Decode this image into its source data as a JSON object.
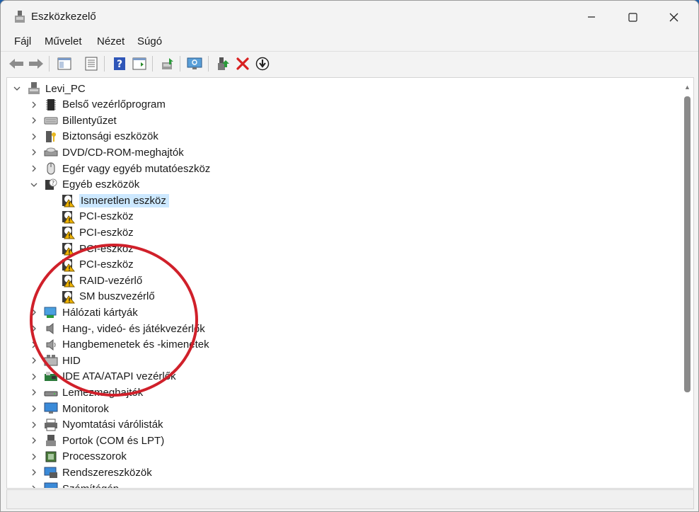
{
  "window": {
    "title": "Eszközkezelő"
  },
  "caption": {
    "minimize": "—",
    "maximize": "☐",
    "close": "✕"
  },
  "menu": {
    "items": [
      "Fájl",
      "Művelet",
      "Nézet",
      "Súgó"
    ]
  },
  "toolbar": {
    "icons": [
      "back-arrow-icon",
      "forward-arrow-icon",
      "properties-pane-icon",
      "details-list-icon",
      "help-icon",
      "action-pane-icon",
      "update-driver-icon",
      "scan-hardware-icon",
      "add-driver-icon",
      "uninstall-icon",
      "disable-icon"
    ]
  },
  "tree": {
    "root": "Levi_PC",
    "categories": [
      {
        "label": "Belső vezérlőprogram",
        "icon": "firmware-chip-icon"
      },
      {
        "label": "Billentyűzet",
        "icon": "keyboard-icon"
      },
      {
        "label": "Biztonsági eszközök",
        "icon": "security-key-icon"
      },
      {
        "label": "DVD/CD-ROM-meghajtók",
        "icon": "dvd-drive-icon"
      },
      {
        "label": "Egér vagy egyéb mutatóeszköz",
        "icon": "mouse-icon"
      },
      {
        "label": "Egyéb eszközök",
        "icon": "unknown-device-icon",
        "expanded": true
      },
      {
        "label": "Hálózati kártyák",
        "icon": "network-adapter-icon"
      },
      {
        "label": "Hang-, videó- és játékvezérlők",
        "icon": "speaker-icon"
      },
      {
        "label": "Hangbemenetek és -kimenetek",
        "icon": "audio-io-icon"
      },
      {
        "label": "HID",
        "icon": "hid-icon"
      },
      {
        "label": "IDE ATA/ATAPI vezérlők",
        "icon": "ide-controller-icon"
      },
      {
        "label": "Lemezmeghajtók",
        "icon": "disk-drive-icon"
      },
      {
        "label": "Monitorok",
        "icon": "monitor-icon"
      },
      {
        "label": "Nyomtatási várólisták",
        "icon": "printer-icon"
      },
      {
        "label": "Portok (COM és LPT)",
        "icon": "port-icon"
      },
      {
        "label": "Processzorok",
        "icon": "processor-icon"
      },
      {
        "label": "Rendszereszközök",
        "icon": "system-device-icon"
      },
      {
        "label": "Számítógép",
        "icon": "computer-icon"
      }
    ],
    "other_devices": [
      {
        "label": "Ismeretlen eszköz",
        "selected": true
      },
      {
        "label": "PCI-eszköz"
      },
      {
        "label": "PCI-eszköz"
      },
      {
        "label": "PCI-eszköz"
      },
      {
        "label": "PCI-eszköz"
      },
      {
        "label": "RAID-vezérlő"
      },
      {
        "label": "SM buszvezérlő"
      }
    ]
  },
  "colors": {
    "annotation_circle": "#d0202a",
    "selection": "#cce8ff",
    "warning": "#f0b400"
  }
}
